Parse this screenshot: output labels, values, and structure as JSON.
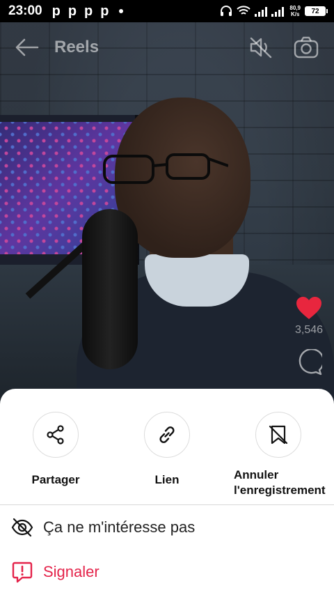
{
  "status_bar": {
    "time": "23:00",
    "app_icons": [
      "p",
      "p",
      "p",
      "p"
    ],
    "net_speed_value": "80,9",
    "net_speed_unit": "K/s",
    "battery": "72"
  },
  "topbar": {
    "title": "Reels",
    "icons": [
      "back-arrow-icon",
      "speaker-muted-icon",
      "camera-icon"
    ]
  },
  "side_actions": {
    "like_count": "3,546",
    "like_color": "#e8263e"
  },
  "share_sheet": {
    "items": [
      {
        "label": "Partager",
        "icon": "share-icon"
      },
      {
        "label": "Lien",
        "icon": "link-icon"
      },
      {
        "label": "Annuler l'enregistrement",
        "icon": "unsave-icon"
      }
    ],
    "menu": [
      {
        "label": "Ça ne m'intéresse pas",
        "icon": "eye-off-icon"
      },
      {
        "label": "Signaler",
        "icon": "report-icon",
        "color": "#e4234a"
      }
    ]
  }
}
